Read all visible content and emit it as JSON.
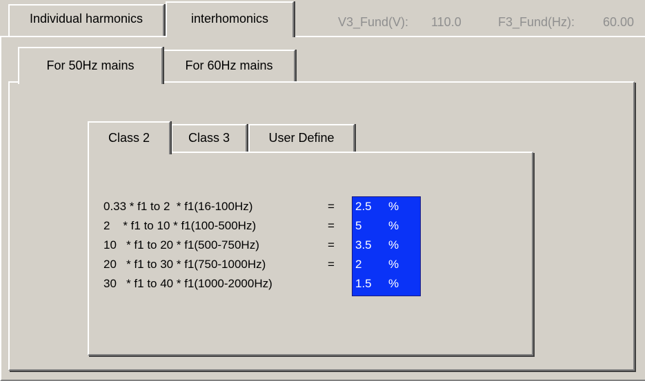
{
  "top_tabs": [
    {
      "label": "Individual harmonics",
      "selected": false
    },
    {
      "label": "interhomonics",
      "selected": true
    }
  ],
  "status": {
    "v3_label": "V3_Fund(V):",
    "v3_value": "110.0",
    "f3_label": "F3_Fund(Hz):",
    "f3_value": "60.00"
  },
  "mains_tabs": [
    {
      "label": "For 50Hz mains",
      "selected": true
    },
    {
      "label": "For 60Hz mains",
      "selected": false
    }
  ],
  "class_tabs": [
    {
      "label": "Class 2",
      "selected": true
    },
    {
      "label": "Class 3",
      "selected": false
    },
    {
      "label": "User Define",
      "selected": false
    }
  ],
  "limits": [
    {
      "range": "0.33 * f1 to 2  * f1(16-100Hz)",
      "eq": "=",
      "value": "2.5",
      "unit": "%"
    },
    {
      "range": "2    * f1 to 10 * f1(100-500Hz)",
      "eq": "=",
      "value": "5",
      "unit": "%"
    },
    {
      "range": "10   * f1 to 20 * f1(500-750Hz)",
      "eq": "=",
      "value": "3.5",
      "unit": "%"
    },
    {
      "range": "20   * f1 to 30 * f1(750-1000Hz)",
      "eq": "=",
      "value": "2",
      "unit": "%"
    },
    {
      "range": "30   * f1 to 40 * f1(1000-2000Hz)",
      "eq": "=",
      "value": "1.5",
      "unit": "%"
    }
  ],
  "colors": {
    "window_bg": "#d4d0c8",
    "selection_bg": "#0a33f7",
    "selection_text": "#ffffff",
    "disabled_text": "#8f8f8f"
  }
}
